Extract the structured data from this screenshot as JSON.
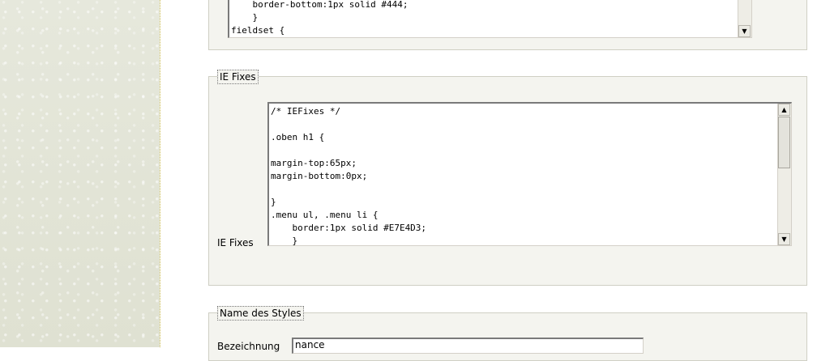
{
  "top_textarea": {
    "content": "    border-bottom:1px solid #444;\n    }\nfieldset {"
  },
  "ie_fixes": {
    "legend": "IE Fixes",
    "label": "IE Fixes",
    "content": "/* IEFixes */\n\n.oben h1 {\n\nmargin-top:65px;\nmargin-bottom:0px;\n\n}\n.menu ul, .menu li {\n    border:1px solid #E7E4D3;\n    }"
  },
  "name_des_styles": {
    "legend": "Name des Styles",
    "label": "Bezeichnung",
    "value": "nance"
  },
  "scrollbar": {
    "up_arrow": "▲",
    "down_arrow": "▼"
  }
}
